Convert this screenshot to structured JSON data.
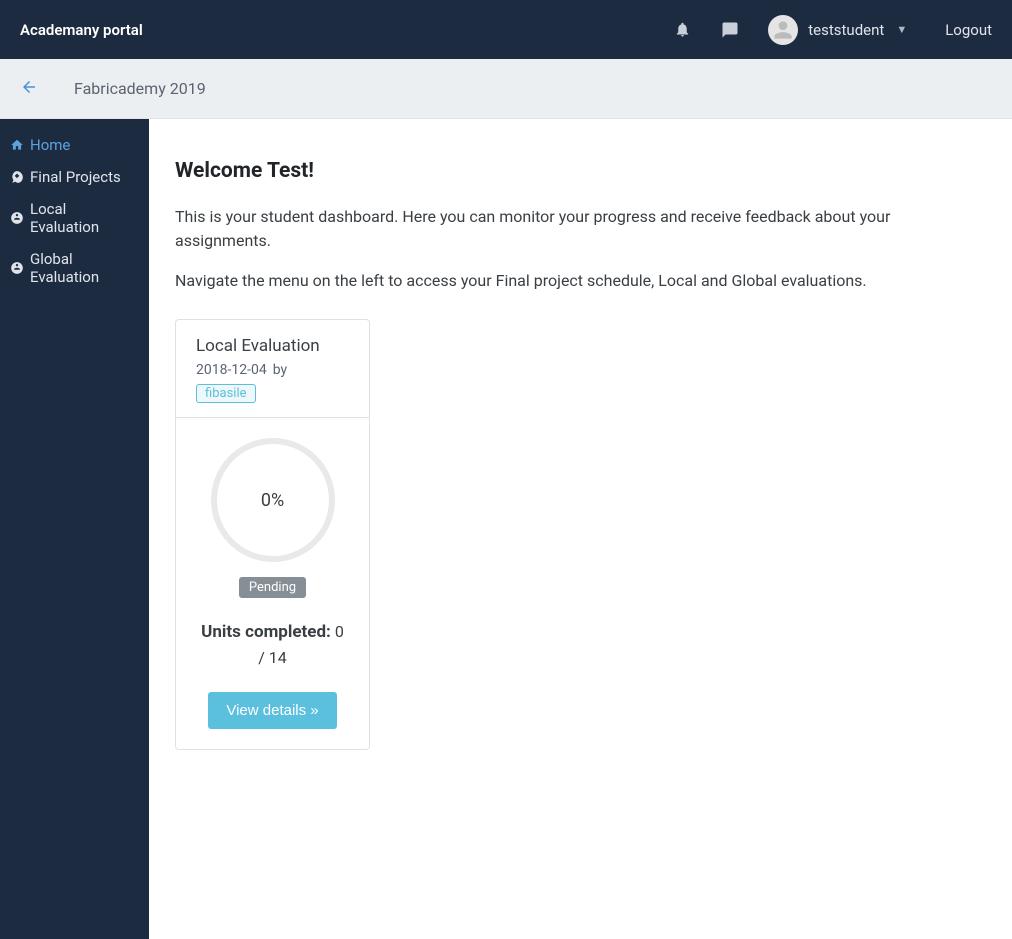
{
  "header": {
    "brand": "Academany portal",
    "username": "teststudent",
    "logout": "Logout"
  },
  "breadcrumb": {
    "course": "Fabricademy 2019"
  },
  "sidebar": {
    "items": [
      {
        "label": "Home",
        "icon": "home-icon"
      },
      {
        "label": "Final Projects",
        "icon": "rocket-icon"
      },
      {
        "label": "Local Evaluation",
        "icon": "dashboard-icon"
      },
      {
        "label": "Global Evaluation",
        "icon": "dashboard-icon"
      }
    ]
  },
  "main": {
    "welcome_title": "Welcome Test!",
    "intro_1": "This is your student dashboard. Here you can monitor your progress and receive feedback about your assignments.",
    "intro_2": "Navigate the menu on the left to access your Final project schedule, Local and Global evaluations."
  },
  "card": {
    "title": "Local Evaluation",
    "date": "2018-12-04",
    "by_label": "by",
    "author": "fibasile",
    "progress_percent": "0%",
    "status": "Pending",
    "units_label": "Units completed:",
    "units_value": "0 / 14",
    "view_details": "View details »"
  }
}
